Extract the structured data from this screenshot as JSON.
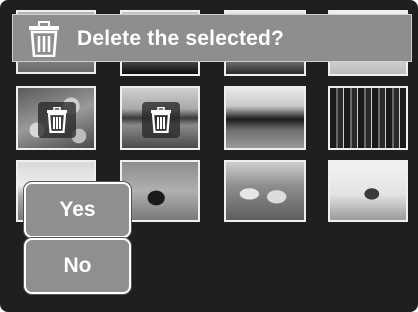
{
  "dialog": {
    "message": "Delete the selected?",
    "icon": "trash-icon"
  },
  "buttons": {
    "yes_label": "Yes",
    "no_label": "No"
  },
  "thumbnails": [
    {
      "subject": "landscape-grass",
      "selected": false
    },
    {
      "subject": "dark-horizon",
      "selected": false
    },
    {
      "subject": "sky-landscape",
      "selected": false
    },
    {
      "subject": "bright-sky",
      "selected": false
    },
    {
      "subject": "lily-pads",
      "selected": true
    },
    {
      "subject": "lake-trees",
      "selected": true
    },
    {
      "subject": "sunset-field",
      "selected": false
    },
    {
      "subject": "pine-forest",
      "selected": false
    },
    {
      "subject": "beach",
      "selected": false
    },
    {
      "subject": "fox",
      "selected": false
    },
    {
      "subject": "sheep",
      "selected": false
    },
    {
      "subject": "geese",
      "selected": false
    }
  ],
  "colors": {
    "screen_bg": "#1f1f1f",
    "banner_bg": "#8e8e8e",
    "button_bg": "#8f8f8f",
    "text": "#ffffff"
  }
}
